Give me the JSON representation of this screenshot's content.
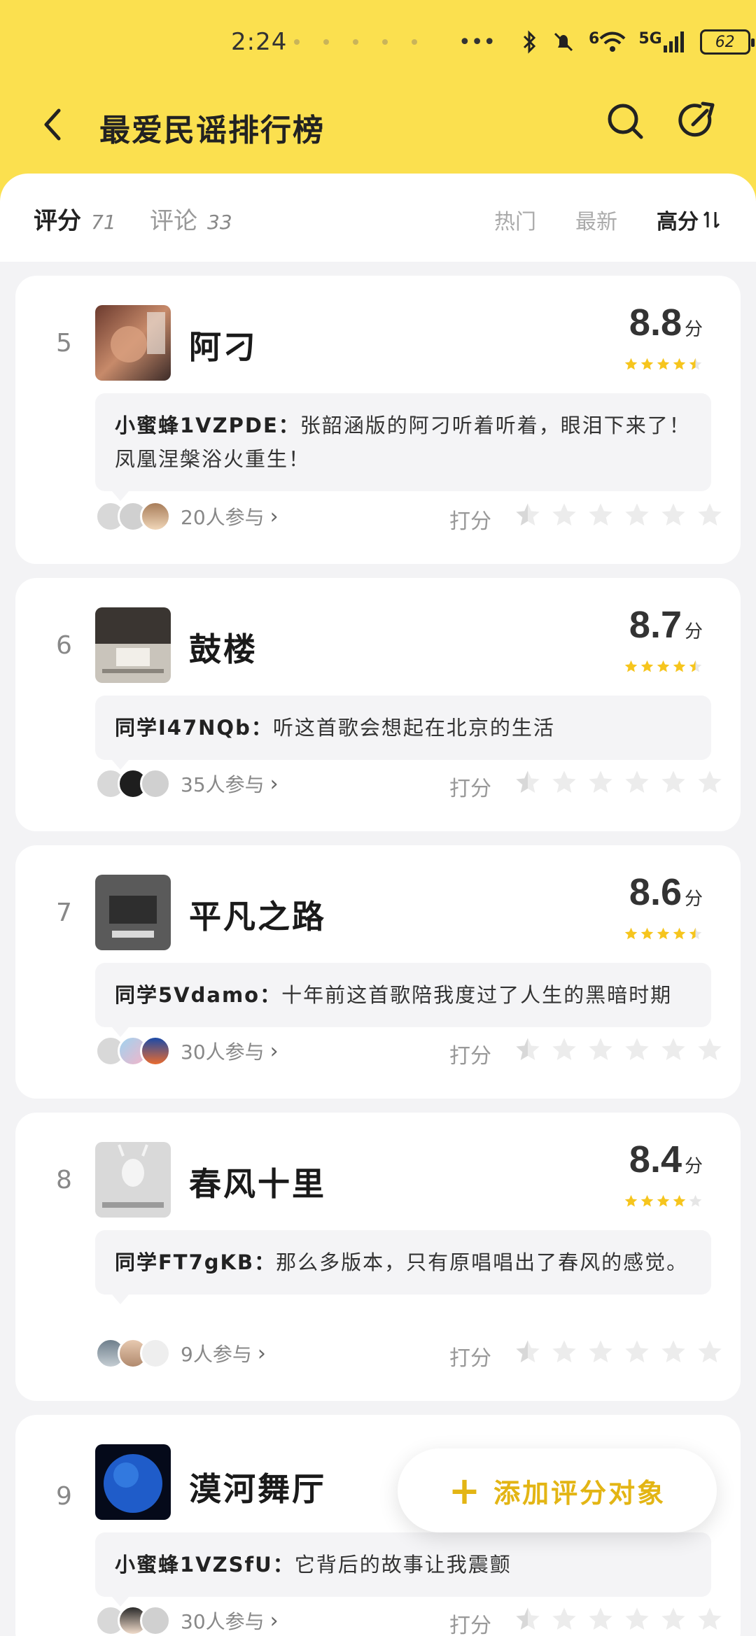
{
  "status_bar": {
    "time": "2:24",
    "more": "•••",
    "network": "5G",
    "wifi_tag": "6",
    "battery": "62"
  },
  "nav": {
    "title": "最爱民谣排行榜"
  },
  "tabs": [
    {
      "label": "评分",
      "count": "71",
      "active": true
    },
    {
      "label": "评论",
      "count": "33",
      "active": false
    }
  ],
  "sorts": [
    {
      "label": "热门",
      "active": false
    },
    {
      "label": "最新",
      "active": false
    },
    {
      "label": "高分",
      "icon": "sort-icon",
      "active": true
    }
  ],
  "items": [
    {
      "rank": "5",
      "title": "阿刁",
      "score": "8.8",
      "unit": "分",
      "star_fill": 4.5,
      "comment_user": "小蜜蜂1VZPDE：",
      "comment_text": "张韶涵版的阿刁听着听着，眼泪下来了！凤凰涅槃浴火重生！",
      "participants": "20人参与",
      "rate_label": "打分"
    },
    {
      "rank": "6",
      "title": "鼓楼",
      "score": "8.7",
      "unit": "分",
      "star_fill": 4.5,
      "comment_user": "同学I47NQb：",
      "comment_text": "听这首歌会想起在北京的生活",
      "participants": "35人参与",
      "rate_label": "打分"
    },
    {
      "rank": "7",
      "title": "平凡之路",
      "score": "8.6",
      "unit": "分",
      "star_fill": 4.5,
      "comment_user": "同学5Vdamo：",
      "comment_text": "十年前这首歌陪我度过了人生的黑暗时期",
      "participants": "30人参与",
      "rate_label": "打分"
    },
    {
      "rank": "8",
      "title": "春风十里",
      "score": "8.4",
      "unit": "分",
      "star_fill": 4,
      "comment_user": "同学FT7gKB：",
      "comment_text": "那么多版本，只有原唱唱出了春风的感觉。",
      "participants": "9人参与",
      "rate_label": "打分"
    },
    {
      "rank": "9",
      "title": "漠河舞厅",
      "score": "",
      "unit": "",
      "star_fill": 0,
      "comment_user": "小蜜蜂1VZSfU：",
      "comment_text": "它背后的故事让我震颤",
      "participants": "30人参与",
      "rate_label": "打分"
    }
  ],
  "fab": {
    "plus": "+",
    "label": "添加评分对象"
  },
  "colors": {
    "header_yellow": "#fbe04f",
    "star_yellow": "#f6c51d",
    "accent": "#e3b514"
  }
}
